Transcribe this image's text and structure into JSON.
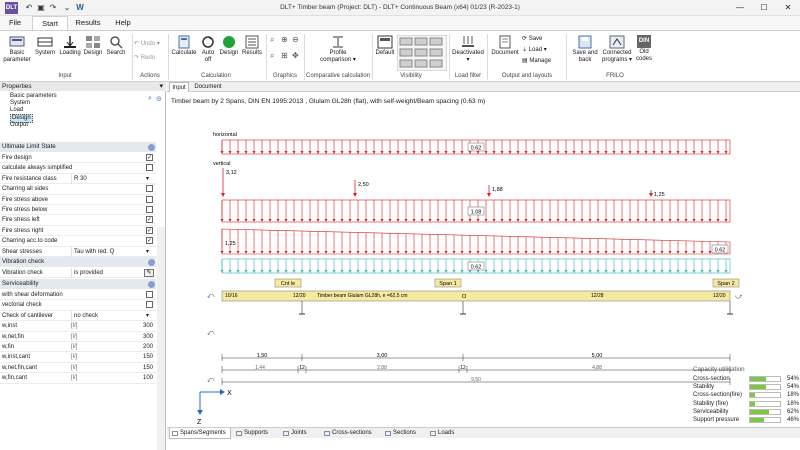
{
  "app": {
    "icon_text": "DLT",
    "title": "DLT+ Timber beam (Project: DLT) - DLT+ Continuous Beam (x64) 01/23 (R-2023-1)"
  },
  "quick": {
    "undo_icon": "undo-icon",
    "redo_icon": "redo-icon",
    "save_icon": "save-icon",
    "word_label": "W"
  },
  "menu": [
    "File",
    "Start",
    "Results",
    "Help"
  ],
  "ribbon": {
    "input": {
      "label": "Input",
      "buttons": [
        "Basic parameter",
        "System",
        "Loading",
        "Design",
        "Search"
      ]
    },
    "actions": {
      "label": "Actions",
      "undo": "Undo",
      "redo": "Redo"
    },
    "calculation": {
      "label": "Calculation",
      "buttons": [
        "Calculate",
        "Auto off",
        "Design",
        "Results"
      ]
    },
    "graphics": {
      "label": "Graphics"
    },
    "comparative": {
      "label": "Comparative calculation",
      "button": "Profile comparison"
    },
    "visibility": {
      "label": "Visibility",
      "button": "Default"
    },
    "loadfilter": {
      "label": "Load filter",
      "button": "Deactivated"
    },
    "output": {
      "label": "Output and layouts",
      "document": "Document",
      "save": "Save",
      "load": "Load",
      "manage": "Manage"
    },
    "friilo": {
      "label": "FRILO",
      "buttons": [
        "Save and back",
        "Connected programs",
        "Old codes"
      ],
      "din": "DIN"
    }
  },
  "properties": {
    "header": "Properties",
    "tree": [
      "Basic parameters",
      "System",
      "Load",
      "Design",
      "Output"
    ],
    "selected": 3
  },
  "uls": {
    "header": "Ultimate Limit State",
    "rows": [
      {
        "label": "Fire design",
        "type": "check",
        "checked": true
      },
      {
        "label": "calculate always simplified",
        "type": "check",
        "checked": false
      },
      {
        "label": "Fire resistance class",
        "type": "select",
        "value": "R 30"
      },
      {
        "label": "Charring all sides",
        "type": "check",
        "checked": false
      },
      {
        "label": "Fire stress above",
        "type": "check",
        "checked": false
      },
      {
        "label": "Fire stress below",
        "type": "check",
        "checked": false
      },
      {
        "label": "Fire stress left",
        "type": "check",
        "checked": true
      },
      {
        "label": "Fire stress right",
        "type": "check",
        "checked": true
      },
      {
        "label": "Charring acc.to code",
        "type": "check",
        "checked": true
      },
      {
        "label": "Shear stresses",
        "type": "select",
        "value": "Tau with red. Q"
      }
    ]
  },
  "vibration": {
    "header": "Vibration check",
    "label": "Vibration check",
    "value": "is provided"
  },
  "serviceability": {
    "header": "Serviceability",
    "rows": [
      {
        "label": "with shear deformation",
        "type": "check",
        "checked": false
      },
      {
        "label": "vectorial check",
        "type": "check",
        "checked": false
      },
      {
        "label": "Check of cantilever",
        "type": "select",
        "value": "no check"
      },
      {
        "label": "w,inst",
        "unit": "[l/]",
        "value": "300"
      },
      {
        "label": "w,net,fin",
        "unit": "[l/]",
        "value": "300"
      },
      {
        "label": "w,fin",
        "unit": "[l/]",
        "value": "200"
      },
      {
        "label": "w,inst,cant",
        "unit": "[l/]",
        "value": "150"
      },
      {
        "label": "w,net,fin,cant",
        "unit": "[l/]",
        "value": "150"
      },
      {
        "label": "w,fin,cant",
        "unit": "[l/]",
        "value": "100"
      }
    ]
  },
  "doctabs": [
    "Input",
    "Document"
  ],
  "canvas": {
    "subtitle": "Timber beam by 2 Spans, DIN EN 1995:2013 , Glulam GL28h (flat), with self-weight/Beam spacing (0.63 m)",
    "horizontal": "horizontal",
    "vertical": "vertical",
    "h_load": "0.62",
    "point_loads": [
      "3,12",
      "2,50",
      "1,88",
      "1,25"
    ],
    "row2": "1.08",
    "row3_left": "1,25",
    "row3_right": "0.62",
    "row4": "0.62",
    "beam_text": "Timber beam Glulam GL28h, e =62,5 cm",
    "beam_marks": [
      "10/16",
      "12/20",
      "12/28",
      "12/20"
    ],
    "span_labels": [
      "Cnt le",
      "Span 1",
      "Span 2"
    ],
    "support_mark": "O",
    "dims_top": [
      "1,50",
      "3,00",
      "5,00"
    ],
    "dims_mid": [
      "1,44",
      "12",
      "2,88",
      "12",
      "4,88"
    ],
    "dims_total": "9,50",
    "axis_x": "X",
    "axis_z": "Z"
  },
  "capacity": {
    "title": "Capacity utilisation",
    "rows": [
      {
        "label": "Cross-section",
        "value": 54
      },
      {
        "label": "Stability",
        "value": 54
      },
      {
        "label": "Cross-section(fire)",
        "value": 18
      },
      {
        "label": "Stability (fire)",
        "value": 18
      },
      {
        "label": "Serviceability",
        "value": 62
      },
      {
        "label": "Support pressure",
        "value": 46
      }
    ]
  },
  "bottomtabs": [
    "Spans/Segments",
    "Supports",
    "Joints",
    "Cross-sections",
    "Sections",
    "Loads"
  ],
  "colors": {
    "load_red": "#d92020",
    "accent_blue": "#2a6bb8",
    "beam_yellow": "#f5eaa0",
    "cyan": "#35b5c0",
    "green": "#7ec646"
  }
}
